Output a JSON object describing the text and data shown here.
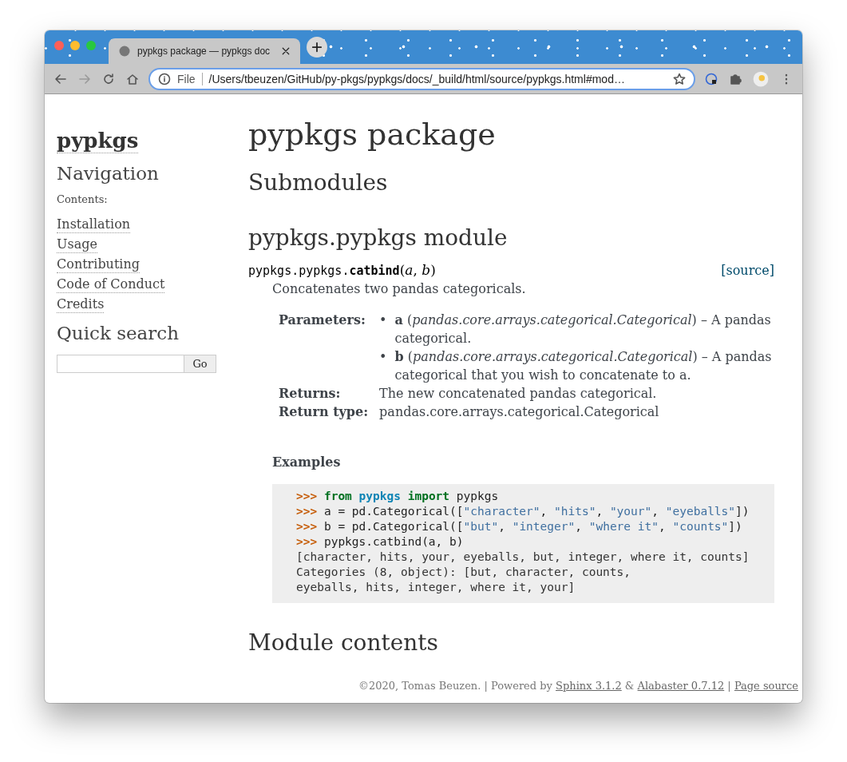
{
  "browser": {
    "tab": {
      "title": "pypkgs package — pypkgs doc",
      "selected": true
    },
    "address": {
      "scheme": "File",
      "url": "/Users/tbeuzen/GitHub/py-pkgs/pypkgs/docs/_build/html/source/pypkgs.html#mod…"
    }
  },
  "sidebar": {
    "logo": "pypkgs",
    "navigation_title": "Navigation",
    "contents_label": "Contents:",
    "items": [
      "Installation",
      "Usage",
      "Contributing",
      "Code of Conduct",
      "Credits"
    ],
    "search_title": "Quick search",
    "search_button": "Go"
  },
  "main": {
    "title": "pypkgs package",
    "submodules_title": "Submodules",
    "module_title": "pypkgs.pypkgs module",
    "signature": {
      "prefix": "pypkgs.pypkgs.",
      "name": "catbind",
      "open": "(",
      "params": [
        "a",
        "b"
      ],
      "separator": ", ",
      "close": ")"
    },
    "source_link": "[source]",
    "description": "Concatenates two pandas categoricals.",
    "fields": [
      {
        "label": "Parameters:",
        "kind": "list",
        "items": [
          {
            "bullet": "•",
            "text": "**a** (*pandas.core.arrays.categorical.Categorical*) – A pandas categorical."
          },
          {
            "bullet": "•",
            "text": "**b** (*pandas.core.arrays.categorical.Categorical*) – A pandas categorical that you wish to concatenate to a."
          }
        ]
      },
      {
        "label": "Returns:",
        "kind": "text",
        "items": [
          "The new concatenated pandas categorical."
        ]
      },
      {
        "label": "Return type:",
        "kind": "text",
        "items": [
          "pandas.core.arrays.categorical.Categorical"
        ]
      }
    ],
    "examples_title": "Examples",
    "code": [
      [
        {
          "kind": "prompt",
          "text": ">>> "
        },
        {
          "kind": "keyword",
          "text": "from "
        },
        {
          "kind": "module",
          "text": "pypkgs"
        },
        {
          "kind": "keyword",
          "text": " import"
        },
        {
          "kind": "plain",
          "text": " pypkgs"
        }
      ],
      [
        {
          "kind": "prompt",
          "text": ">>> "
        },
        {
          "kind": "plain",
          "text": "a = pd.Categorical(["
        },
        {
          "kind": "string",
          "text": "\"character\""
        },
        {
          "kind": "plain",
          "text": ", "
        },
        {
          "kind": "string",
          "text": "\"hits\""
        },
        {
          "kind": "plain",
          "text": ", "
        },
        {
          "kind": "string",
          "text": "\"your\""
        },
        {
          "kind": "plain",
          "text": ", "
        },
        {
          "kind": "string",
          "text": "\"eyeballs\""
        },
        {
          "kind": "plain",
          "text": "])"
        }
      ],
      [
        {
          "kind": "prompt",
          "text": ">>> "
        },
        {
          "kind": "plain",
          "text": "b = pd.Categorical(["
        },
        {
          "kind": "string",
          "text": "\"but\""
        },
        {
          "kind": "plain",
          "text": ", "
        },
        {
          "kind": "string",
          "text": "\"integer\""
        },
        {
          "kind": "plain",
          "text": ", "
        },
        {
          "kind": "string",
          "text": "\"where it\""
        },
        {
          "kind": "plain",
          "text": ", "
        },
        {
          "kind": "string",
          "text": "\"counts\""
        },
        {
          "kind": "plain",
          "text": "])"
        }
      ],
      [
        {
          "kind": "prompt",
          "text": ">>> "
        },
        {
          "kind": "plain",
          "text": "pypkgs.catbind(a, b)"
        }
      ],
      [
        {
          "kind": "output",
          "text": "[character, hits, your, eyeballs, but, integer, where it, counts]"
        }
      ],
      [
        {
          "kind": "output",
          "text": "Categories (8, object): [but, character, counts,"
        }
      ],
      [
        {
          "kind": "output",
          "text": "eyeballs, hits, integer, where it, your]"
        }
      ]
    ],
    "contents_title": "Module contents"
  },
  "footer": [
    {
      "kind": "text",
      "text": "©2020, Tomas Beuzen. | Powered by "
    },
    {
      "kind": "link",
      "text": "Sphinx 3.1.2"
    },
    {
      "kind": "text",
      "text": " & "
    },
    {
      "kind": "link",
      "text": "Alabaster 0.7.12"
    },
    {
      "kind": "text",
      "text": " | "
    },
    {
      "kind": "link",
      "text": "Page source"
    }
  ]
}
